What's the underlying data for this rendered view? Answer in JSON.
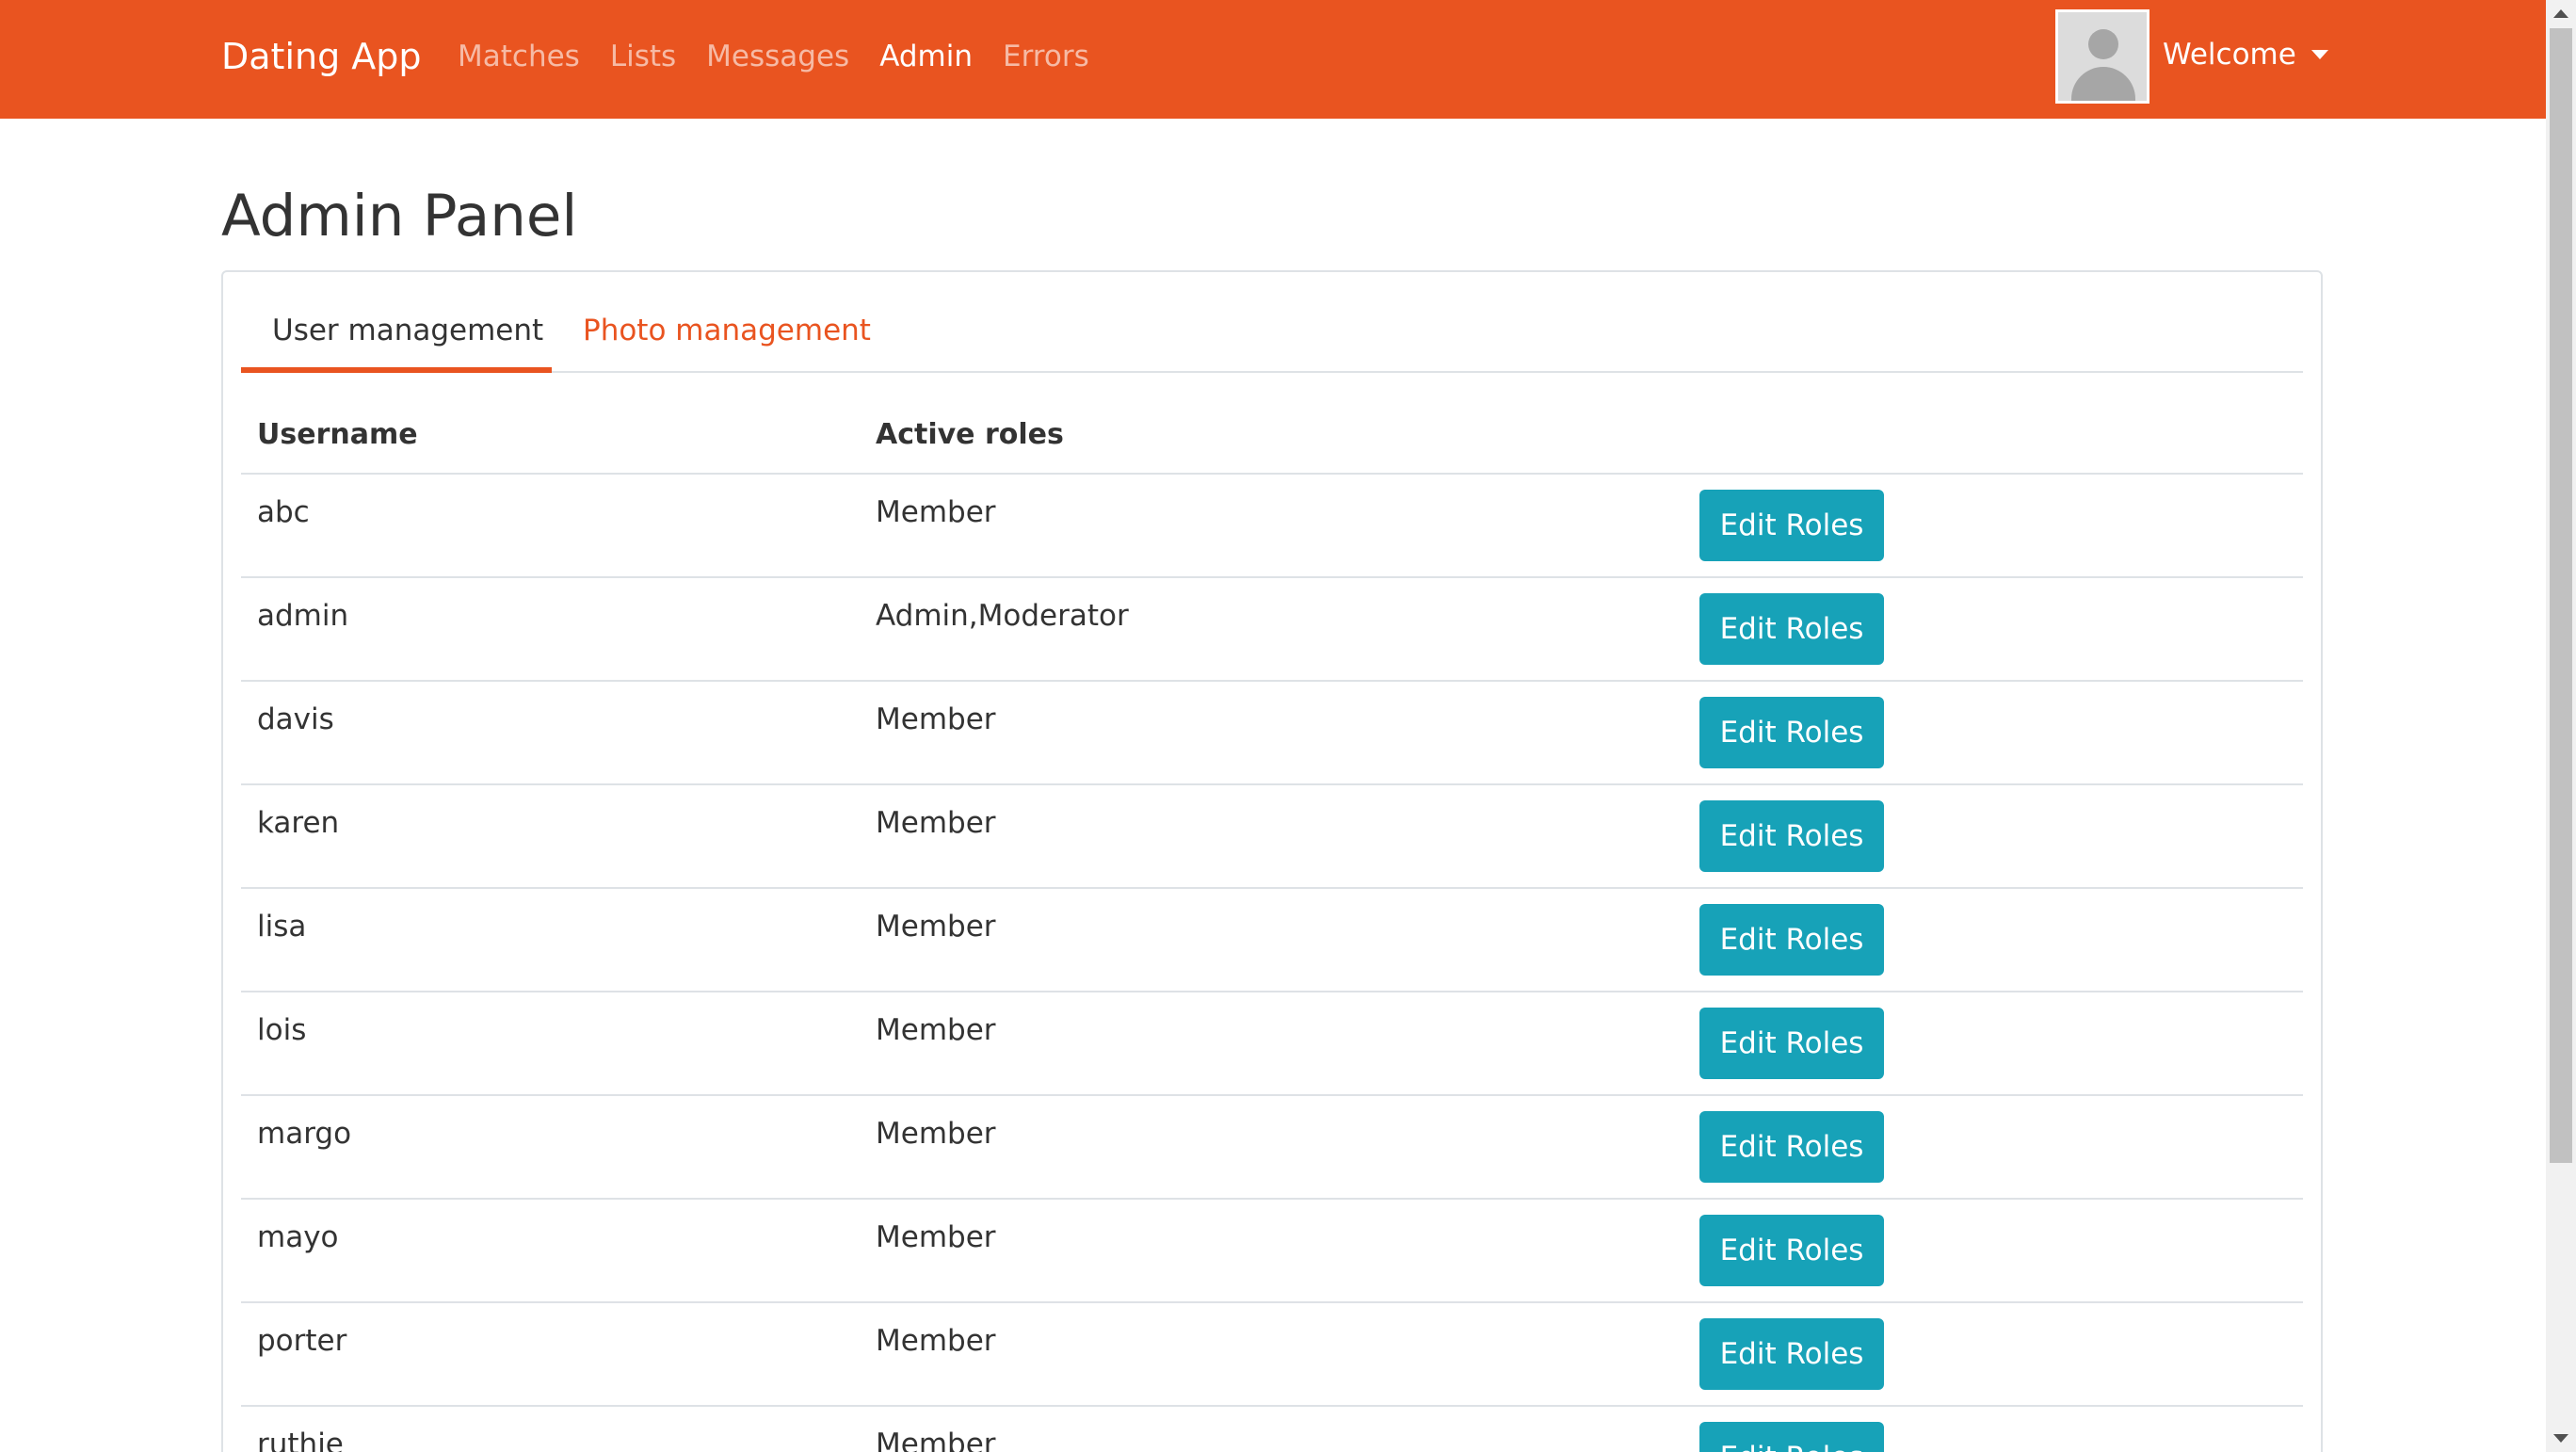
{
  "navbar": {
    "brand": "Dating App",
    "links": [
      "Matches",
      "Lists",
      "Messages",
      "Admin",
      "Errors"
    ],
    "active_link": "Admin",
    "welcome": "Welcome",
    "accent_color": "#e95420"
  },
  "page": {
    "title": "Admin Panel"
  },
  "tabs": [
    {
      "label": "User management",
      "active": true
    },
    {
      "label": "Photo management",
      "active": false
    }
  ],
  "table": {
    "headers": [
      "Username",
      "Active roles",
      ""
    ],
    "rows": [
      {
        "username": "abc",
        "roles": "Member",
        "action": "Edit Roles"
      },
      {
        "username": "admin",
        "roles": "Admin,Moderator",
        "action": "Edit Roles"
      },
      {
        "username": "davis",
        "roles": "Member",
        "action": "Edit Roles"
      },
      {
        "username": "karen",
        "roles": "Member",
        "action": "Edit Roles"
      },
      {
        "username": "lisa",
        "roles": "Member",
        "action": "Edit Roles"
      },
      {
        "username": "lois",
        "roles": "Member",
        "action": "Edit Roles"
      },
      {
        "username": "margo",
        "roles": "Member",
        "action": "Edit Roles"
      },
      {
        "username": "mayo",
        "roles": "Member",
        "action": "Edit Roles"
      },
      {
        "username": "porter",
        "roles": "Member",
        "action": "Edit Roles"
      },
      {
        "username": "ruthie",
        "roles": "Member",
        "action": "Edit Roles"
      }
    ],
    "button_color": "#17a2b8"
  },
  "icons": {
    "avatar": "user-avatar-placeholder",
    "dropdown": "caret-down-icon"
  }
}
